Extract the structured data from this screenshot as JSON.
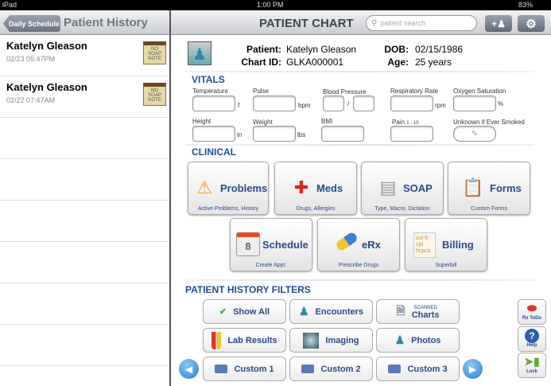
{
  "status": {
    "device": "iPad",
    "time": "1:00 PM",
    "battery": "83%"
  },
  "left": {
    "back": "Daily Schedule",
    "title": "Patient History",
    "items": [
      {
        "name": "Katelyn Gleason",
        "date": "02/23 05:47PM",
        "badge": "NO SOAP NOTE"
      },
      {
        "name": "Katelyn Gleason",
        "date": "02/22 07:47AM",
        "badge": "NO SOAP NOTE"
      }
    ]
  },
  "header": {
    "title": "PATIENT CHART",
    "search_placeholder": "patient search"
  },
  "patient": {
    "patient_label": "Patient:",
    "patient": "Katelyn Gleason",
    "chart_label": "Chart ID:",
    "chart": "GLKA000001",
    "dob_label": "DOB:",
    "dob": "02/15/1986",
    "age_label": "Age:",
    "age": "25 years"
  },
  "vitals": {
    "title": "VITALS",
    "temperature": "Temperature",
    "temp_unit": "f",
    "pulse": "Pulse",
    "pulse_unit": "bpm",
    "bp": "Blood Pressure",
    "bp_sep": "/",
    "resp": "Respiratory Rate",
    "resp_unit": "rpm",
    "oxygen": "Oxygen Saturation",
    "oxygen_unit": "%",
    "height": "Height",
    "height_unit": "in",
    "weight": "Weight",
    "weight_unit": "lbs",
    "bmi": "BMI",
    "pain": "Pain",
    "pain_range": "1 - 10",
    "smoked": "Unknown if Ever Smoked"
  },
  "clinical": {
    "title": "CLINICAL",
    "tiles": [
      {
        "t": "Problems",
        "s": "Active Problems, History"
      },
      {
        "t": "Meds",
        "s": "Drugs, Allergies"
      },
      {
        "t": "SOAP",
        "s": "Type, Macro, Dictation"
      },
      {
        "t": "Forms",
        "s": "Custom Forms"
      },
      {
        "t": "Schedule",
        "s": "Create Appt.",
        "icon_text": "8"
      },
      {
        "t": "eRx",
        "s": "Prescribe Drugs"
      },
      {
        "t": "Billing",
        "s": "Superbill",
        "icon_text": "icd-9 cpt hcpcs"
      }
    ]
  },
  "filters": {
    "title": "PATIENT HISTORY FILTERS",
    "show_all": "Show All",
    "encounters": "Encounters",
    "scanned": "SCANNED",
    "charts": "Charts",
    "lab": "Lab Results",
    "imaging": "Imaging",
    "photos": "Photos",
    "c1": "Custom 1",
    "c2": "Custom 2",
    "c3": "Custom 3"
  },
  "side": {
    "rx": "Rx ToDo",
    "help": "Help",
    "lock": "Lock"
  }
}
